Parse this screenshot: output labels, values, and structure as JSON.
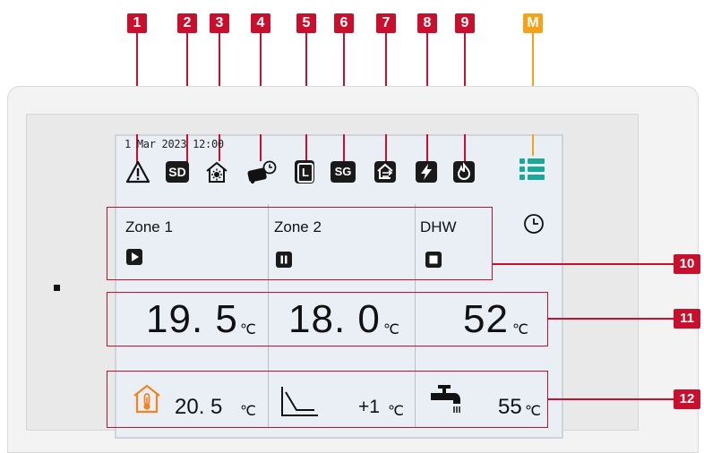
{
  "callouts": {
    "b1": "1",
    "b2": "2",
    "b3": "3",
    "b4": "4",
    "b5": "5",
    "b6": "6",
    "b7": "7",
    "b8": "8",
    "b9": "9",
    "bm": "M",
    "b10": "10",
    "b11": "11",
    "b12": "12"
  },
  "status_bar": {
    "datetime": "1 Mar 2023 12:00",
    "icons": [
      "warning-icon",
      "sd-card-icon",
      "house-sun-icon",
      "unit-timer-icon",
      "l-mode-icon",
      "sg-icon",
      "house-export-icon",
      "bolt-icon",
      "flame-icon",
      "menu-icon"
    ],
    "sd_label": "SD",
    "l_label": "L",
    "sg_label": "SG"
  },
  "zones": [
    {
      "label": "Zone 1",
      "status": "play-icon",
      "temp": "19. 5",
      "unit": "℃"
    },
    {
      "label": "Zone 2",
      "status": "pause-icon",
      "temp": "18. 0",
      "unit": "℃"
    },
    {
      "label": "DHW",
      "status": "stop-icon",
      "temp": "52",
      "unit": "℃"
    }
  ],
  "bottom": {
    "room_temp": "20. 5",
    "room_unit": "℃",
    "curve_offset": "+1",
    "curve_unit": "℃",
    "dhw_temp": "55",
    "dhw_unit": "℃"
  },
  "colors": {
    "callout": "#c8102e",
    "menu_callout": "#f5a21b",
    "menu_icon": "#1aa89a",
    "room_icon": "#f0841e"
  }
}
